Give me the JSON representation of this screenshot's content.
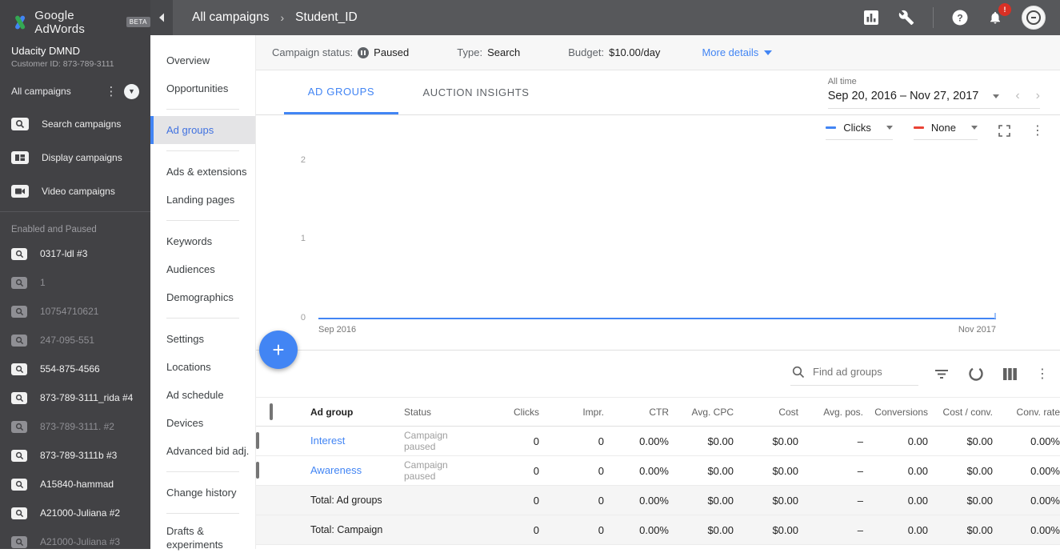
{
  "topbar": {
    "brand": "Google AdWords",
    "beta": "BETA",
    "breadcrumb_root": "All campaigns",
    "breadcrumb_sep": "›",
    "breadcrumb_current": "Student_ID",
    "notification_badge": "!"
  },
  "account": {
    "name": "Udacity DMND",
    "customer_id": "Customer ID: 873-789-3111",
    "scope": "All campaigns"
  },
  "campaign_types": [
    "Search campaigns",
    "Display campaigns",
    "Video campaigns"
  ],
  "campaigns": {
    "section_label": "Enabled and Paused",
    "items": [
      {
        "label": "0317-ldl #3",
        "state": "enabled"
      },
      {
        "label": "1",
        "state": "paused"
      },
      {
        "label": "10754710621",
        "state": "paused"
      },
      {
        "label": "247-095-551",
        "state": "paused"
      },
      {
        "label": "554-875-4566",
        "state": "enabled"
      },
      {
        "label": "873-789-3111_rida #4",
        "state": "enabled"
      },
      {
        "label": "873-789-3111. #2",
        "state": "paused"
      },
      {
        "label": "873-789-3111b #3",
        "state": "enabled"
      },
      {
        "label": "A15840-hammad",
        "state": "enabled"
      },
      {
        "label": "A21000-Juliana #2",
        "state": "enabled"
      },
      {
        "label": "A21000-Juliana #3",
        "state": "paused"
      }
    ]
  },
  "nav": {
    "items": [
      "Overview",
      "Opportunities",
      "Ad groups",
      "Ads & extensions",
      "Landing pages",
      "Keywords",
      "Audiences",
      "Demographics",
      "Settings",
      "Locations",
      "Ad schedule",
      "Devices",
      "Advanced bid adj.",
      "Change history",
      "Drafts & experiments"
    ],
    "selected": "Ad groups"
  },
  "status_bar": {
    "campaign_status_label": "Campaign status:",
    "campaign_status_value": "Paused",
    "type_label": "Type:",
    "type_value": "Search",
    "budget_label": "Budget:",
    "budget_value": "$10.00/day",
    "more_details": "More details"
  },
  "tabs": [
    {
      "label": "AD GROUPS",
      "selected": true
    },
    {
      "label": "AUCTION INSIGHTS",
      "selected": false
    }
  ],
  "date_range": {
    "preset": "All time",
    "value": "Sep 20, 2016 – Nov 27, 2017"
  },
  "chart_controls": {
    "metric1_label": "Clicks",
    "metric1_color": "#4285f4",
    "metric2_label": "None",
    "metric2_color": "#ea4335"
  },
  "chart_data": {
    "type": "line",
    "title": "",
    "series": [
      {
        "name": "Clicks",
        "color": "#4285f4",
        "x": [
          "Sep 20, 2016",
          "Nov 27, 2017"
        ],
        "values": [
          0,
          0
        ]
      },
      {
        "name": "None",
        "color": "#ea4335",
        "values": []
      }
    ],
    "ylim": [
      0,
      2
    ],
    "yticks": [
      "2",
      "1",
      "0"
    ],
    "xticks": [
      "Sep 2016",
      "Nov 2017"
    ],
    "grid": false,
    "legend_position": "top-right"
  },
  "toolbar": {
    "search_placeholder": "Find ad groups"
  },
  "table": {
    "columns": [
      "Ad group",
      "Status",
      "Clicks",
      "Impr.",
      "CTR",
      "Avg. CPC",
      "Cost",
      "Avg. pos.",
      "Conversions",
      "Cost / conv.",
      "Conv. rate"
    ],
    "rows": [
      {
        "ad_group": "Interest",
        "status": "Campaign paused",
        "clicks": "0",
        "impr": "0",
        "ctr": "0.00%",
        "avg_cpc": "$0.00",
        "cost": "$0.00",
        "avg_pos": "–",
        "conversions": "0.00",
        "cost_conv": "$0.00",
        "conv_rate": "0.00%"
      },
      {
        "ad_group": "Awareness",
        "status": "Campaign paused",
        "clicks": "0",
        "impr": "0",
        "ctr": "0.00%",
        "avg_cpc": "$0.00",
        "cost": "$0.00",
        "avg_pos": "–",
        "conversions": "0.00",
        "cost_conv": "$0.00",
        "conv_rate": "0.00%"
      }
    ],
    "totals": [
      {
        "label": "Total: Ad groups",
        "clicks": "0",
        "impr": "0",
        "ctr": "0.00%",
        "avg_cpc": "$0.00",
        "cost": "$0.00",
        "avg_pos": "–",
        "conversions": "0.00",
        "cost_conv": "$0.00",
        "conv_rate": "0.00%"
      },
      {
        "label": "Total: Campaign",
        "clicks": "0",
        "impr": "0",
        "ctr": "0.00%",
        "avg_cpc": "$0.00",
        "cost": "$0.00",
        "avg_pos": "–",
        "conversions": "0.00",
        "cost_conv": "$0.00",
        "conv_rate": "0.00%"
      }
    ]
  }
}
